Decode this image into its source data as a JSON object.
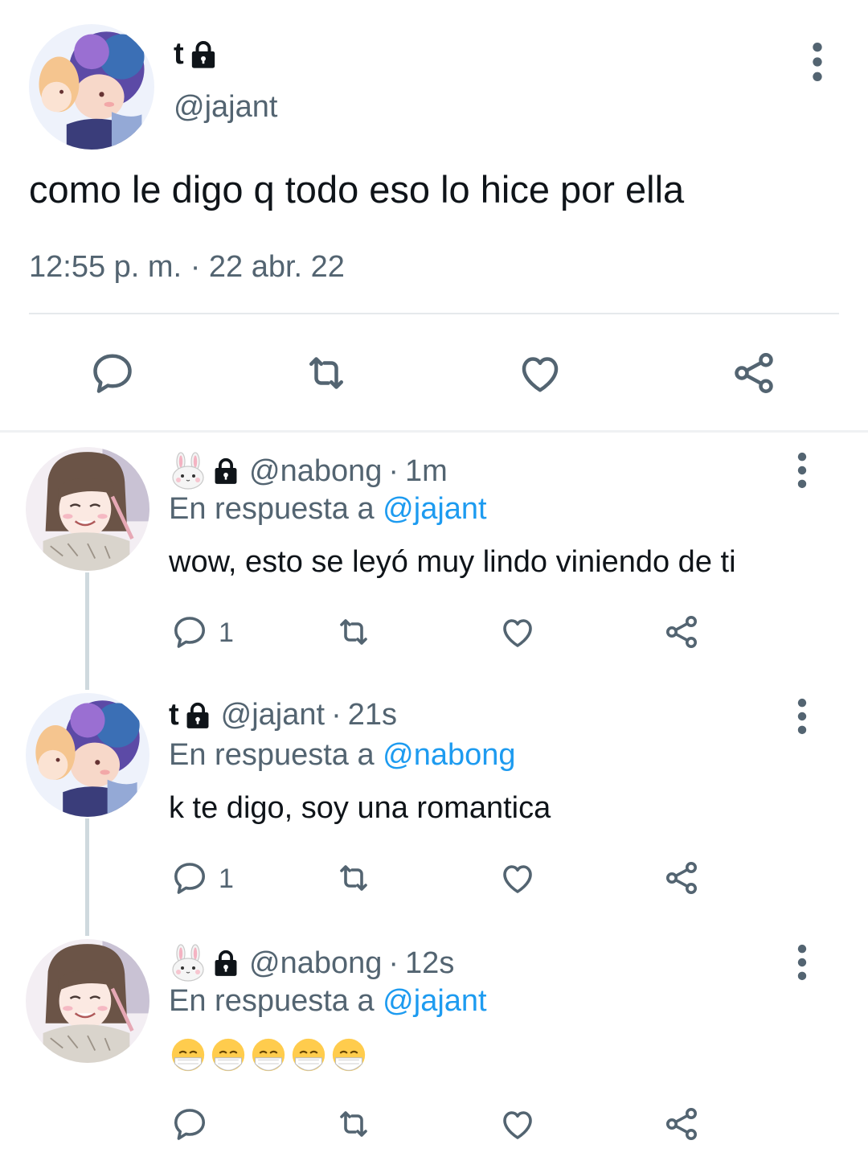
{
  "main_tweet": {
    "display_name": "t",
    "handle": "@jajant",
    "text": "como le digo q todo eso lo hice por ella",
    "time": "12:55 p. m.",
    "separator": "·",
    "date": "22 abr. 22",
    "actions": [
      "reply-icon",
      "retweet-icon",
      "like-icon",
      "share-icon"
    ]
  },
  "replies": [
    {
      "display_name_emoji": "rabbit-face-icon",
      "handle": "@nabong",
      "separator": "·",
      "time": "1m",
      "reply_to_label": "En respuesta a",
      "reply_to_handle": "@jajant",
      "text": "wow, esto se leyó muy lindo viniendo de ti",
      "reply_count": "1"
    },
    {
      "display_name": "t",
      "handle": "@jajant",
      "separator": "·",
      "time": "21s",
      "reply_to_label": "En respuesta a",
      "reply_to_handle": "@nabong",
      "text": "k te digo, soy una romantica",
      "reply_count": "1"
    },
    {
      "display_name_emoji": "rabbit-face-icon",
      "handle": "@nabong",
      "separator": "·",
      "time": "12s",
      "reply_to_label": "En respuesta a",
      "reply_to_handle": "@jajant",
      "text_emojis": [
        "mask-face-icon",
        "mask-face-icon",
        "mask-face-icon",
        "mask-face-icon",
        "mask-face-icon"
      ],
      "reply_count": ""
    }
  ],
  "colors": {
    "text": "#0f1419",
    "secondary": "#536471",
    "link": "#1d9bf0",
    "divider": "#e6e9ec",
    "thread_line": "#cfd9de"
  }
}
